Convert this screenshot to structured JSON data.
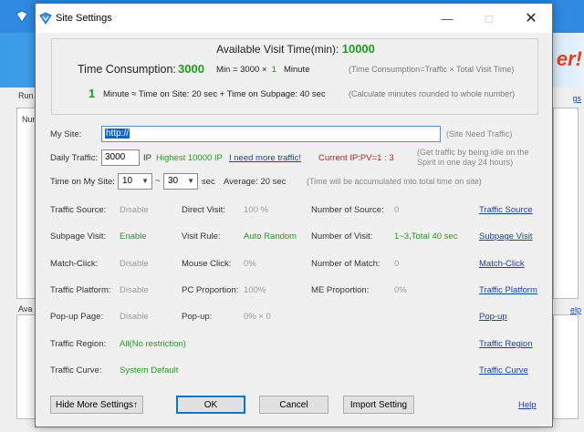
{
  "background": {
    "side_labels": [
      "Run",
      "Num",
      "Ava"
    ],
    "banner_text": "er!",
    "right_links": [
      "gs",
      "elp"
    ]
  },
  "dialog": {
    "title": "Site Settings",
    "summary": {
      "available_label": "Available Visit Time(min):",
      "available_value": "10000",
      "consumption_label": "Time Consumption:",
      "consumption_value": "3000",
      "formula_prefix": "Min = 3000 ×",
      "formula_mult": "1",
      "formula_unit": "Minute",
      "consumption_note": "(Time Consumption=Traffic × Total Visit Time)",
      "minute_value": "1",
      "minute_text": "Minute ≈ Time on Site: 20 sec + Time on Subpage: 40 sec",
      "minute_note": "(Calculate minutes rounded to whole number)"
    },
    "my_site": {
      "label": "My Site:",
      "value": "http://",
      "note": "(Site Need Traffic)"
    },
    "daily_traffic": {
      "label": "Daily Traffic:",
      "value": "3000",
      "unit": "IP",
      "highest": "Highest 10000 IP",
      "need_more_link": "I need more traffic!",
      "current_ip": "Current IP:PV=1 : 3",
      "note_line1": "(Get traffic by being idle on the",
      "note_line2": "Spirit in one day 24 hours)"
    },
    "time_on_site": {
      "label": "Time on My Site:",
      "min_value": "10",
      "separator": "~",
      "max_value": "30",
      "unit": "sec",
      "average": "Average: 20 sec",
      "note": "(Time will be accumulated into total time on site)"
    },
    "rows": [
      {
        "label1": "Traffic Source:",
        "value1": "Disable",
        "label2": "Direct Visit:",
        "value2": "100 %",
        "label3": "Number of Source:",
        "value3": "0",
        "link": "Traffic Source"
      },
      {
        "label1": "Subpage Visit:",
        "value1": "Enable",
        "label2": "Visit Rule:",
        "value2": "Auto Random",
        "label3": "Number of Visit:",
        "value3": "1~3,Total 40 sec",
        "link": "Subpage Visit"
      },
      {
        "label1": "Match-Click:",
        "value1": "Disable",
        "label2": "Mouse Click:",
        "value2": "0%",
        "label3": "Number of Match:",
        "value3": "0",
        "link": "Match-Click"
      },
      {
        "label1": "Traffic Platform:",
        "value1": "Disable",
        "label2": "PC Proportion:",
        "value2": "100%",
        "label3": "ME Proportion:",
        "value3": "0%",
        "link": "Traffic Platform"
      },
      {
        "label1": "Pop-up Page:",
        "value1": "Disable",
        "label2": "Pop-up:",
        "value2": "0% × 0",
        "label3": "",
        "value3": "",
        "link": "Pop-up"
      },
      {
        "label1": "Traffic Region:",
        "value1": "All(No restriction)",
        "label2": "",
        "value2": "",
        "label3": "",
        "value3": "",
        "link": "Traffic Region"
      },
      {
        "label1": "Traffic Curve:",
        "value1": "System Default",
        "label2": "",
        "value2": "",
        "label3": "",
        "value3": "",
        "link": "Traffic Curve"
      }
    ],
    "buttons": {
      "hide_more": "Hide More Settings↑",
      "ok": "OK",
      "cancel": "Cancel",
      "import": "Import Setting",
      "help": "Help"
    },
    "colors": {
      "accent_green": "#1e9e1e",
      "link_blue": "#1a3fb0",
      "current_ip_red": "#b22222"
    }
  }
}
